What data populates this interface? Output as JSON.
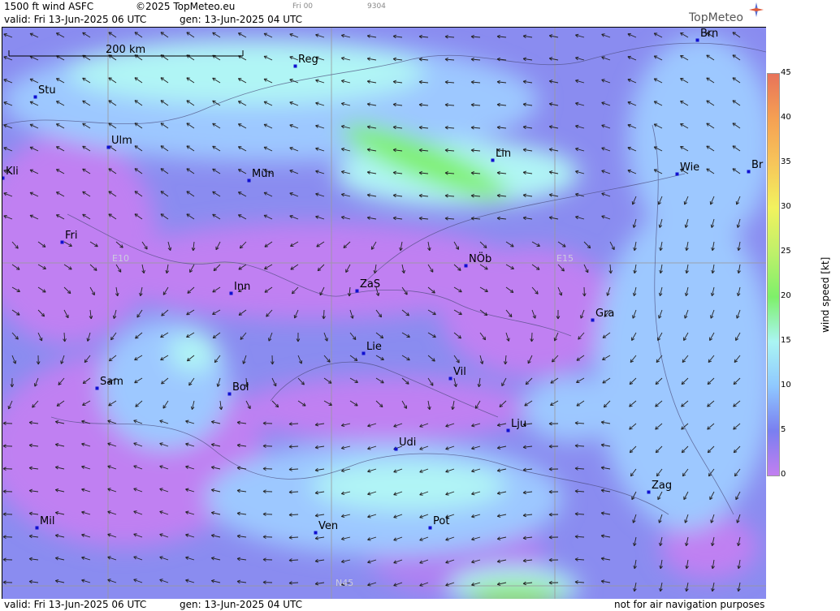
{
  "header": {
    "product": "1500 ft wind ASFC",
    "copyright": "©2025 TopMeteo.eu",
    "run_code": "Fri 00",
    "frame_code": "9304",
    "valid": "valid:  Fri  13-Jun-2025  06 UTC",
    "generated": "gen: 13-Jun-2025 04 UTC",
    "brand": "TopMeteo"
  },
  "footer": {
    "valid": "valid:  Fri  13-Jun-2025  06 UTC",
    "generated": "gen: 13-Jun-2025 04 UTC",
    "disclaimer": "not for air navigation purposes"
  },
  "scale_bar": "200 km",
  "gridlines": {
    "lon_labels": [
      "E10",
      "E15"
    ],
    "lat_labels": [
      "N45"
    ]
  },
  "cities": [
    {
      "name": "Stu"
    },
    {
      "name": "Ulm"
    },
    {
      "name": "Reg"
    },
    {
      "name": "Brn"
    },
    {
      "name": "Kli"
    },
    {
      "name": "Mün"
    },
    {
      "name": "Lin"
    },
    {
      "name": "Wie"
    },
    {
      "name": "Br"
    },
    {
      "name": "Fri"
    },
    {
      "name": "NÖb"
    },
    {
      "name": "Inn"
    },
    {
      "name": "ZaS"
    },
    {
      "name": "Gra"
    },
    {
      "name": "Lie"
    },
    {
      "name": "Vil"
    },
    {
      "name": "Sam"
    },
    {
      "name": "Bol"
    },
    {
      "name": "Lju"
    },
    {
      "name": "Udi"
    },
    {
      "name": "Zag"
    },
    {
      "name": "Mil"
    },
    {
      "name": "Ven"
    },
    {
      "name": "Pot"
    }
  ],
  "colorbar": {
    "title": "wind  speed  [kt]",
    "ticks": [
      "45",
      "40",
      "35",
      "30",
      "25",
      "20",
      "15",
      "10",
      "5",
      "0"
    ],
    "colors": [
      "#e8735a",
      "#f5a053",
      "#f7c55a",
      "#f2f25e",
      "#bff06a",
      "#7ef06a",
      "#aaf5f3",
      "#8fc8ff",
      "#7a7ff0",
      "#c27ff0"
    ]
  }
}
